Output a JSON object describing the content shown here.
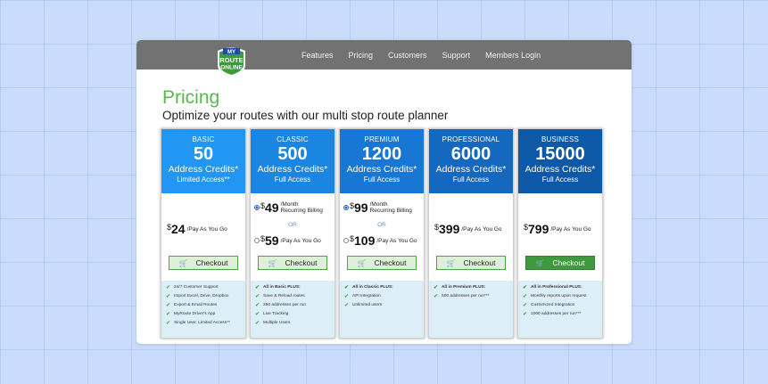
{
  "logo": {
    "line1": "MY",
    "line2": "ROUTE",
    "line3": "ONLINE"
  },
  "nav": [
    "Features",
    "Pricing",
    "Customers",
    "Support",
    "Members Login"
  ],
  "heading": "Pricing",
  "subheading": "Optimize your routes with our multi stop route planner",
  "colors": {
    "heading": "#58b84b",
    "basic": "#2196f3",
    "classic": "#1a86e2",
    "premium": "#1877d4",
    "professional": "#1468bf",
    "business": "#0e58a8",
    "checkout": "#dff0d8",
    "checkout_dark": "#3f9a3f",
    "features_bg": "#dceff8"
  },
  "plans": [
    {
      "tier": "BASIC",
      "credits": "50",
      "credits_label": "Address Credits*",
      "access": "Limited Access**",
      "price": {
        "currency": "$",
        "amount": "24",
        "per": "/Pay As You Go"
      },
      "checkout": "Checkout",
      "features": [
        "24/7 Customer Support",
        "Import Excel, Drive, Dropbox",
        "Export & Email Routes",
        "MyRoute Driver's App",
        "Single User, Limited Access**"
      ]
    },
    {
      "tier": "CLASSIC",
      "credits": "500",
      "credits_label": "Address Credits*",
      "access": "Full Access",
      "monthly": {
        "currency": "$",
        "amount": "49",
        "per_line1": "/Month",
        "per_line2": "Recurring Billing"
      },
      "or": "OR",
      "alt": {
        "currency": "$",
        "amount": "59",
        "per": "/Pay As You Go"
      },
      "checkout": "Checkout",
      "features": [
        "All in Basic PLUS:",
        "Save & Reload routes",
        "350 addresses per run",
        "Live Tracking",
        "Multiple Users"
      ]
    },
    {
      "tier": "PREMIUM",
      "credits": "1200",
      "credits_label": "Address Credits*",
      "access": "Full Access",
      "monthly": {
        "currency": "$",
        "amount": "99",
        "per_line1": "/Month",
        "per_line2": "Recurring Billing"
      },
      "or": "OR",
      "alt": {
        "currency": "$",
        "amount": "109",
        "per": "/Pay As You Go"
      },
      "checkout": "Checkout",
      "features": [
        "All in Classic PLUS:",
        "API Integration",
        "Unlimited users"
      ]
    },
    {
      "tier": "PROFESSIONAL",
      "credits": "6000",
      "credits_label": "Address Credits*",
      "access": "Full Access",
      "price": {
        "currency": "$",
        "amount": "399",
        "per": "/Pay As You Go"
      },
      "checkout": "Checkout",
      "features": [
        "All in Premium PLUS:",
        "500 addresses per run***"
      ]
    },
    {
      "tier": "BUSINESS",
      "credits": "15000",
      "credits_label": "Address Credits*",
      "access": "Full Access",
      "price": {
        "currency": "$",
        "amount": "799",
        "per": "/Pay As You Go"
      },
      "checkout": "Checkout",
      "features": [
        "All in Professional PLUS:",
        "Monthly reports upon request",
        "Customized Integration",
        "1000 addresses per run***"
      ]
    }
  ]
}
